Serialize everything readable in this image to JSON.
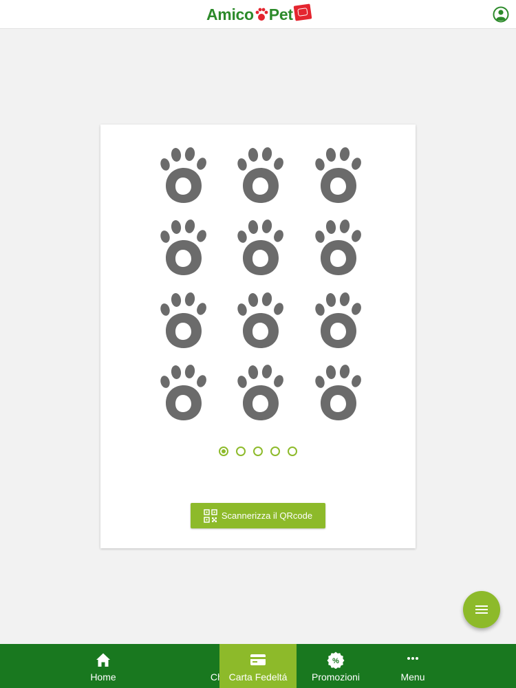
{
  "header": {
    "logo_text_left": "Amico",
    "logo_text_right": "Pet",
    "profile_icon": "user-circle-icon"
  },
  "card": {
    "stamp_icon": "paw-stamp-icon",
    "stamp_count": 12,
    "pages": 5,
    "active_page": 1,
    "scan_button_label": "Scannerizza il QRcode",
    "scan_button_icon": "qr-code-icon"
  },
  "fab": {
    "icon": "menu-lines-icon"
  },
  "bottom_nav": {
    "items": [
      {
        "label": "Home",
        "icon": "house-icon"
      },
      {
        "label": "Chi siamo",
        "icon": "dog-icon"
      },
      {
        "label": "Carta Fedeltá",
        "icon": "credit-card-icon",
        "active": true
      },
      {
        "label": "Promozioni",
        "icon": "percent-badge-icon"
      },
      {
        "label": "Menu",
        "icon": "more-dots-icon"
      }
    ]
  },
  "colors": {
    "brand_green": "#2c8a2a",
    "nav_green": "#19781f",
    "accent_lime": "#8dba2a",
    "stamp_gray": "#6b6b6b",
    "logo_red": "#e4252f"
  }
}
